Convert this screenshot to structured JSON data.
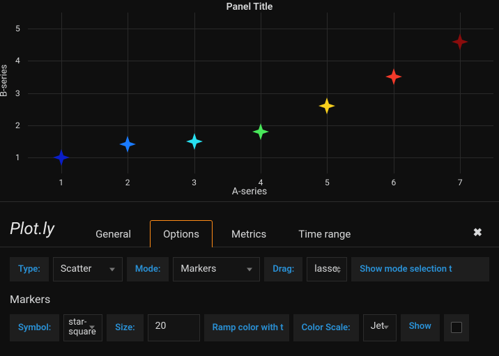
{
  "chart_data": {
    "type": "scatter",
    "title": "Panel Title",
    "xlabel": "A-series",
    "ylabel": "B-series",
    "xlim": [
      0.5,
      7.5
    ],
    "ylim": [
      0.5,
      5.5
    ],
    "x_ticks": [
      1,
      2,
      3,
      4,
      5,
      6,
      7
    ],
    "y_ticks": [
      1,
      2,
      3,
      4,
      5
    ],
    "symbol": "star-square",
    "colorscale": "Jet",
    "points": [
      {
        "x": 1,
        "y": 1.0,
        "color": "#0a1ec8"
      },
      {
        "x": 2,
        "y": 1.4,
        "color": "#1a7bff"
      },
      {
        "x": 3,
        "y": 1.5,
        "color": "#28dff0"
      },
      {
        "x": 4,
        "y": 1.8,
        "color": "#49e75a"
      },
      {
        "x": 5,
        "y": 2.6,
        "color": "#f7cf1d"
      },
      {
        "x": 6,
        "y": 3.5,
        "color": "#f23a2a"
      },
      {
        "x": 7,
        "y": 4.6,
        "color": "#8a0c0c"
      }
    ]
  },
  "brand": "Plot.ly",
  "tabs": [
    {
      "label": "General",
      "active": false
    },
    {
      "label": "Options",
      "active": true
    },
    {
      "label": "Metrics",
      "active": false
    },
    {
      "label": "Time range",
      "active": false
    }
  ],
  "controls": {
    "type": {
      "label": "Type:",
      "value": "Scatter"
    },
    "mode": {
      "label": "Mode:",
      "value": "Markers"
    },
    "drag": {
      "label": "Drag:",
      "value": "lasso"
    },
    "show_mode_link": "Show mode selection t",
    "markers_heading": "Markers",
    "symbol": {
      "label": "Symbol:",
      "value": "star-square"
    },
    "size": {
      "label": "Size:",
      "value": "20"
    },
    "ramp_label": "Ramp color with t",
    "colorscale": {
      "label": "Color Scale:",
      "value": "Jet"
    },
    "show_link": "Show",
    "checkbox_checked": false
  }
}
